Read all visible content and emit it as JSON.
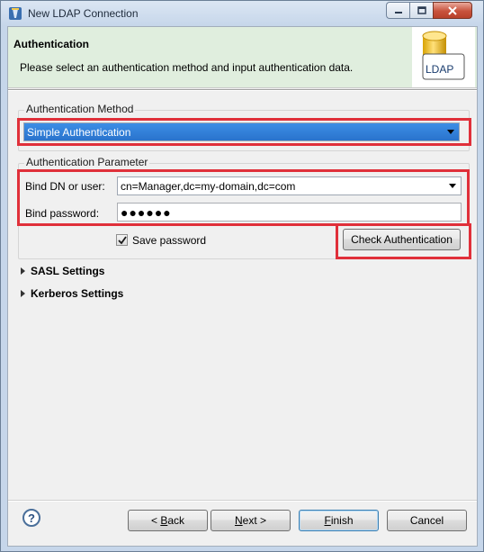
{
  "window": {
    "title": "New LDAP Connection"
  },
  "banner": {
    "title": "Authentication",
    "description": "Please select an authentication method and input authentication data.",
    "image_label": "LDAP"
  },
  "auth_method": {
    "group_title": "Authentication Method",
    "selected": "Simple Authentication"
  },
  "auth_parameter": {
    "group_title": "Authentication Parameter",
    "bind_dn_label": "Bind DN or user:",
    "bind_dn_value": "cn=Manager,dc=my-domain,dc=com",
    "bind_password_label": "Bind password:",
    "bind_password_value": "●●●●●●",
    "save_password_label": "Save password",
    "save_password_checked": true,
    "check_button_label": "Check Authentication"
  },
  "sections": {
    "sasl": "SASL Settings",
    "kerberos": "Kerberos Settings"
  },
  "footer": {
    "back_prefix": "< ",
    "back_mnemonic": "B",
    "back_rest": "ack",
    "next_mnemonic": "N",
    "next_rest": "ext >",
    "finish_mnemonic": "F",
    "finish_rest": "inish",
    "cancel_label": "Cancel"
  },
  "colors": {
    "highlight": "#e0303a",
    "banner_bg": "#e0eede",
    "selection": "#2a73cc"
  }
}
